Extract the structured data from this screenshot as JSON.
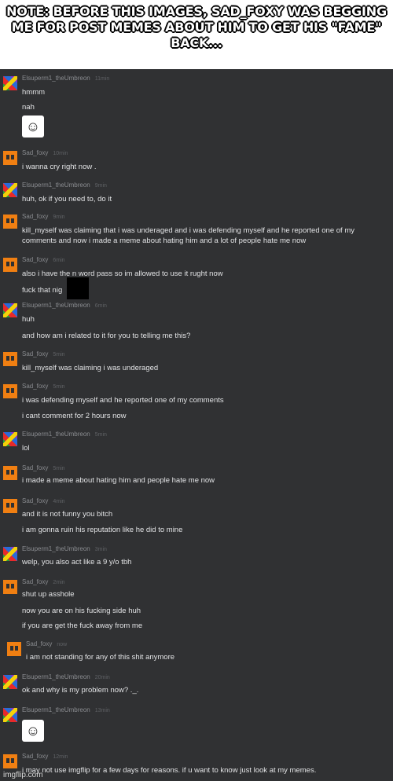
{
  "header": {
    "note": "NOTE: BEFORE THIS IMAGES, SAD_FOXY WAS BEGGING ME FOR POST MEMES ABOUT HIM TO GET HIS \"FAME\" BACK..."
  },
  "messages": [
    {
      "user": "Elsuperm1_theUmbreon",
      "time": "11min",
      "avatar": "umbreon-avatar",
      "lines": [
        "hmmm",
        "nah"
      ],
      "sticker": "derp-face-icon"
    },
    {
      "user": "Sad_foxy",
      "time": "10min",
      "avatar": "foxy-avatar",
      "lines": [
        "i wanna cry right now ."
      ]
    },
    {
      "user": "Elsuperm1_theUmbreon",
      "time": "9min",
      "avatar": "umbreon-avatar",
      "lines": [
        "huh, ok if you need to, do it"
      ]
    },
    {
      "user": "Sad_foxy",
      "time": "9min",
      "avatar": "foxy-avatar",
      "lines": [
        "kill_myself was claiming that i was underaged and i was defending myself and he reported one of my",
        "comments and now i made a meme about hating him and a lot of people hate me now"
      ]
    },
    {
      "user": "Sad_foxy",
      "time": "6min",
      "avatar": "foxy-avatar",
      "lines": [
        "also i have the n word pass so im allowed to use it rught now",
        "fuck that nig"
      ]
    },
    {
      "user": "Elsuperm1_theUmbreon",
      "time": "6min",
      "avatar": "umbreon-avatar",
      "lines": [
        "huh",
        "and how am i related to it for you to telling me this?"
      ]
    },
    {
      "user": "Sad_foxy",
      "time": "5min",
      "avatar": "foxy-avatar",
      "lines": [
        "kill_myself was claiming i was underaged"
      ]
    },
    {
      "user": "Sad_foxy",
      "time": "5min",
      "avatar": "foxy-avatar",
      "lines": [
        "i was defending myself and he reported one of my comments",
        "i cant comment for 2 hours now"
      ]
    },
    {
      "user": "Elsuperm1_theUmbreon",
      "time": "5min",
      "avatar": "umbreon-avatar",
      "lines": [
        "lol"
      ]
    },
    {
      "user": "Sad_foxy",
      "time": "5min",
      "avatar": "foxy-avatar",
      "lines": [
        "i made a meme about hating him and people hate me now"
      ]
    },
    {
      "user": "Sad_foxy",
      "time": "4min",
      "avatar": "foxy-avatar",
      "lines": [
        "and it is not funny you bitch",
        "i am gonna ruin his reputation like he did to mine"
      ]
    },
    {
      "user": "Elsuperm1_theUmbreon",
      "time": "3min",
      "avatar": "umbreon-avatar",
      "lines": [
        "welp, you also act like a 9 y/o tbh"
      ]
    },
    {
      "user": "Sad_foxy",
      "time": "2min",
      "avatar": "foxy-avatar",
      "lines": [
        "shut up asshole",
        "now you are on his fucking side huh",
        "if you are get the fuck away from me"
      ]
    },
    {
      "user": "Sad_foxy",
      "time": "now",
      "avatar": "foxy-avatar",
      "lines": [
        "i am not standing for any of this shit anymore"
      ]
    },
    {
      "user": "Elsuperm1_theUmbreon",
      "time": "20min",
      "avatar": "umbreon-avatar",
      "lines": [
        "ok and why is my problem now? ._."
      ]
    },
    {
      "user": "Elsuperm1_theUmbreon",
      "time": "13min",
      "avatar": "umbreon-avatar",
      "lines": [],
      "sticker": "derp-face-icon"
    },
    {
      "user": "Sad_foxy",
      "time": "12min",
      "avatar": "foxy-avatar",
      "lines": [
        "i may not use imgflip for a few days for reasons. if u want to know just look at my memes."
      ]
    }
  ],
  "watermark": "imgflip.com"
}
